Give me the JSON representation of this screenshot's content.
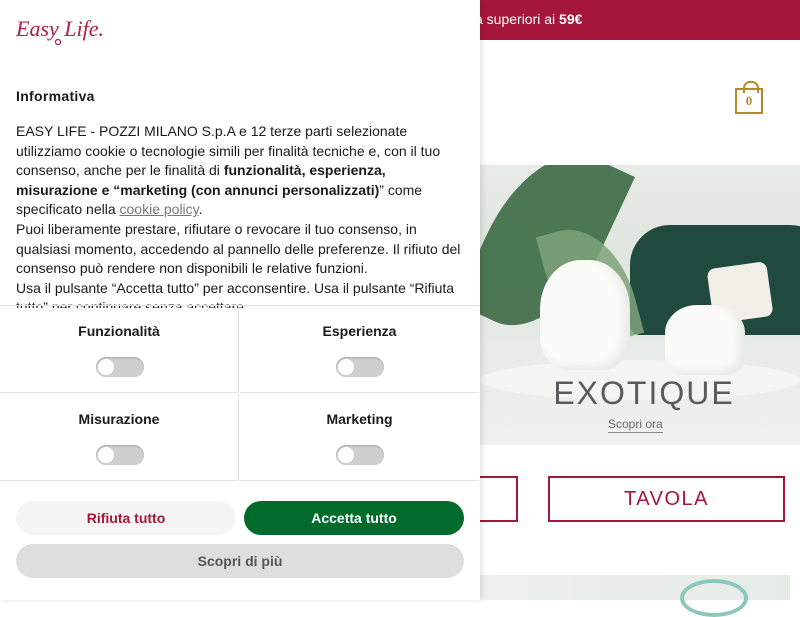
{
  "site": {
    "promo_text": "a superiori ai ",
    "promo_amount": "59€",
    "cart_count": "0",
    "hero_title": "EXOTIQUE",
    "hero_cta": "Scopri ora",
    "category_button": "TAVOLA"
  },
  "cookie": {
    "logo_text": "Easy Life.",
    "title": "Informativa",
    "body": {
      "p1_a": "EASY LIFE - POZZI MILANO S.p.A e 12 terze parti selezionate utilizziamo cookie o tecnologie simili per finalità tecniche e, con il tuo consenso, anche per le finalità di ",
      "p1_bold1": "funzionalità, esperienza, misurazione e “marketing (con annunci personalizzati)",
      "p1_b": "” come specificato nella ",
      "p1_link": "cookie policy",
      "p1_c": ".",
      "p2": "Puoi liberamente prestare, rifiutare o revocare il tuo consenso, in qualsiasi momento, accedendo al pannello delle preferenze. Il rifiuto del consenso può rendere non disponibili le relative funzioni.",
      "p3": "Usa il pulsante “Accetta tutto” per acconsentire. Usa il pulsante “Rifiuta tutto” per continuare senza accettare."
    },
    "categories": [
      {
        "label": "Funzionalità",
        "enabled": false
      },
      {
        "label": "Esperienza",
        "enabled": false
      },
      {
        "label": "Misurazione",
        "enabled": false
      },
      {
        "label": "Marketing",
        "enabled": false
      }
    ],
    "buttons": {
      "reject": "Rifiuta tutto",
      "accept": "Accetta tutto",
      "more": "Scopri di più"
    }
  },
  "colors": {
    "brand": "#a5173a",
    "accept": "#006b2a",
    "gold": "#b58a2a"
  }
}
